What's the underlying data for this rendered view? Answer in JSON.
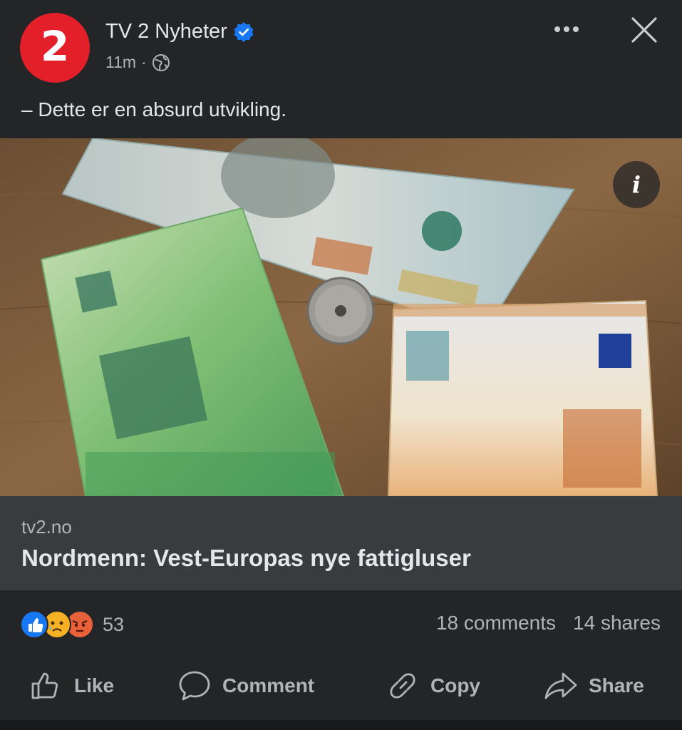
{
  "post": {
    "page_name": "TV 2 Nyheter",
    "avatar_text": "2",
    "time": "11m",
    "separator": "·",
    "text": "– Dette er en absurd utvikling.",
    "image_icon": "info-icon",
    "info_glyph": "i"
  },
  "link": {
    "domain": "tv2.no",
    "title": "Nordmenn: Vest-Europas nye fattigluser"
  },
  "engagement": {
    "reaction_count": "53",
    "comments": "18 comments",
    "shares": "14 shares"
  },
  "actions": {
    "like": "Like",
    "comment": "Comment",
    "copy": "Copy",
    "share": "Share"
  },
  "colors": {
    "background": "#242526",
    "card": "#3a3b3c",
    "brand_red": "#e3202a",
    "verified_blue": "#1877f2"
  }
}
